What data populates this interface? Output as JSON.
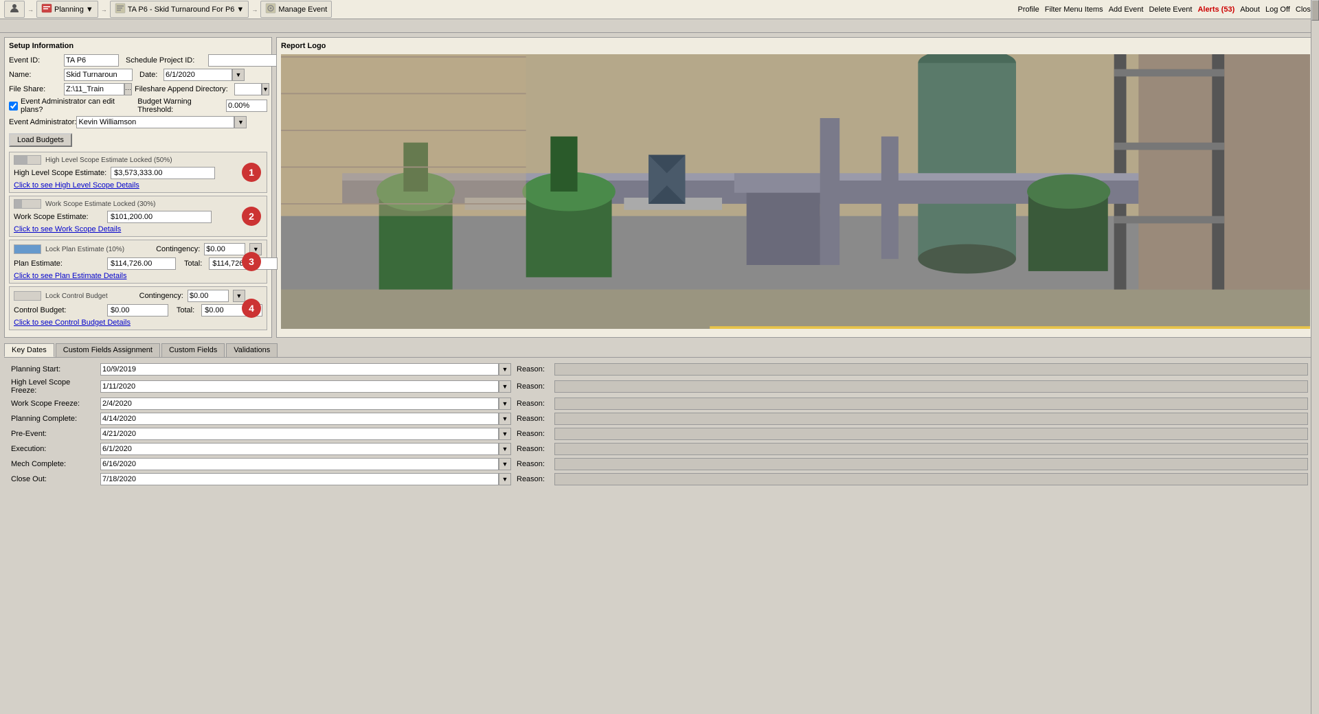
{
  "topbar": {
    "profile_label": "Profile",
    "filter_label": "Filter Menu Items",
    "add_event_label": "Add Event",
    "delete_event_label": "Delete Event",
    "alerts_label": "Alerts (53)",
    "about_label": "About",
    "logout_label": "Log Off",
    "close_label": "Close",
    "nav_items": [
      {
        "id": "user",
        "label": "",
        "icon": "user-icon"
      },
      {
        "id": "planning",
        "label": "Planning",
        "icon": "planning-icon",
        "has_arrow": true
      },
      {
        "id": "event",
        "label": "TA P6 - Skid Turnaround For P6",
        "icon": "event-icon",
        "has_arrow": true
      },
      {
        "id": "manage",
        "label": "Manage Event",
        "icon": "manage-icon"
      }
    ]
  },
  "setup_panel": {
    "title": "Setup Information",
    "event_id_label": "Event ID:",
    "event_id_value": "TA P6",
    "schedule_project_id_label": "Schedule Project ID:",
    "schedule_project_id_value": "",
    "name_label": "Name:",
    "name_value": "Skid Turnaroun",
    "date_label": "Date:",
    "date_value": "6/1/2020",
    "file_share_label": "File Share:",
    "file_share_value": "Z:\\11_Train",
    "fileshare_append_label": "Fileshare Append Directory:",
    "fileshare_append_value": "",
    "event_admin_can_edit_label": "Event Administrator can edit plans?",
    "budget_warning_label": "Budget Warning Threshold:",
    "budget_warning_value": "0.00%",
    "event_admin_label": "Event Administrator:",
    "event_admin_value": "Kevin Williamson",
    "load_budgets_label": "Load Budgets"
  },
  "high_level_scope": {
    "lock_label": "High Level Scope Estimate Locked (50%)",
    "estimate_label": "High Level Scope Estimate:",
    "estimate_value": "$3,573,333.00",
    "link_label": "Click to see High Level Scope Details",
    "badge": "1"
  },
  "work_scope": {
    "lock_label": "Work Scope Estimate Locked (30%)",
    "estimate_label": "Work Scope Estimate:",
    "estimate_value": "$101,200.00",
    "link_label": "Click to see Work Scope Details",
    "badge": "2"
  },
  "plan_estimate": {
    "lock_label": "Lock Plan Estimate (10%)",
    "contingency_label": "Contingency:",
    "contingency_value": "$0.00",
    "plan_estimate_label": "Plan Estimate:",
    "plan_estimate_value": "$114,726.00",
    "total_label": "Total:",
    "total_value": "$114,726.00",
    "link_label": "Click to see Plan Estimate Details",
    "badge": "3"
  },
  "control_budget": {
    "lock_label": "Lock Control Budget",
    "contingency_label": "Contingency:",
    "contingency_value": "$0.00",
    "budget_label": "Control Budget:",
    "budget_value": "$0.00",
    "total_label": "Total:",
    "total_value": "$0.00",
    "link_label": "Click to see Control Budget Details",
    "badge": "4"
  },
  "report_logo": {
    "title": "Report Logo"
  },
  "tabs": [
    {
      "id": "key-dates",
      "label": "Key Dates",
      "active": true
    },
    {
      "id": "custom-fields-assignment",
      "label": "Custom Fields Assignment",
      "active": false
    },
    {
      "id": "custom-fields",
      "label": "Custom Fields",
      "active": false
    },
    {
      "id": "validations",
      "label": "Validations",
      "active": false
    }
  ],
  "key_dates": {
    "rows": [
      {
        "label": "Planning Start:",
        "date": "10/9/2019",
        "reason_label": "Reason:"
      },
      {
        "label": "High Level Scope Freeze:",
        "date": "1/11/2020",
        "reason_label": "Reason:"
      },
      {
        "label": "Work Scope Freeze:",
        "date": "2/4/2020",
        "reason_label": "Reason:"
      },
      {
        "label": "Planning Complete:",
        "date": "4/14/2020",
        "reason_label": "Reason:"
      },
      {
        "label": "Pre-Event:",
        "date": "4/21/2020",
        "reason_label": "Reason:"
      },
      {
        "label": "Execution:",
        "date": "6/1/2020",
        "reason_label": "Reason:"
      },
      {
        "label": "Mech Complete:",
        "date": "6/16/2020",
        "reason_label": "Reason:"
      },
      {
        "label": "Close Out:",
        "date": "7/18/2020",
        "reason_label": "Reason:"
      }
    ]
  }
}
